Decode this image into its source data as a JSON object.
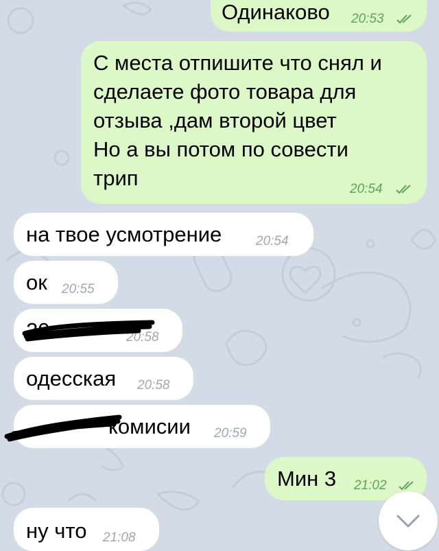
{
  "colors": {
    "background": "#d3dce6",
    "incoming_bubble": "#ffffff",
    "outgoing_bubble": "#dcf8c6",
    "outgoing_time": "#5fa35a",
    "incoming_time": "#a0a7ae"
  },
  "messages": [
    {
      "direction": "outgoing",
      "lines": [
        "Одинаково"
      ],
      "time": "20:53",
      "status": "read"
    },
    {
      "direction": "outgoing",
      "lines": [
        "С места отпишите что снял и",
        "сделаете фото товара для",
        "отзыва ,дам второй цвет",
        "Но а вы потом по совести",
        "трип"
      ],
      "time": "20:54",
      "status": "read"
    },
    {
      "direction": "incoming",
      "lines": [
        "на твое усмотрение"
      ],
      "time": "20:54"
    },
    {
      "direction": "incoming",
      "lines": [
        "ок"
      ],
      "time": "20:55"
    },
    {
      "direction": "incoming",
      "lines": [
        "20"
      ],
      "time": "20:58",
      "redacted": true
    },
    {
      "direction": "incoming",
      "lines": [
        "одесская"
      ],
      "time": "20:58"
    },
    {
      "direction": "incoming",
      "lines": [
        "комисии"
      ],
      "time": "20:59",
      "redacted": true
    },
    {
      "direction": "outgoing",
      "lines": [
        "Мин 3"
      ],
      "time": "21:02",
      "status": "read"
    },
    {
      "direction": "incoming",
      "lines": [
        "ну что"
      ],
      "time": "21:08"
    }
  ],
  "scroll_button_icon": "chevron-down-icon",
  "status_icon": "double-check-icon"
}
